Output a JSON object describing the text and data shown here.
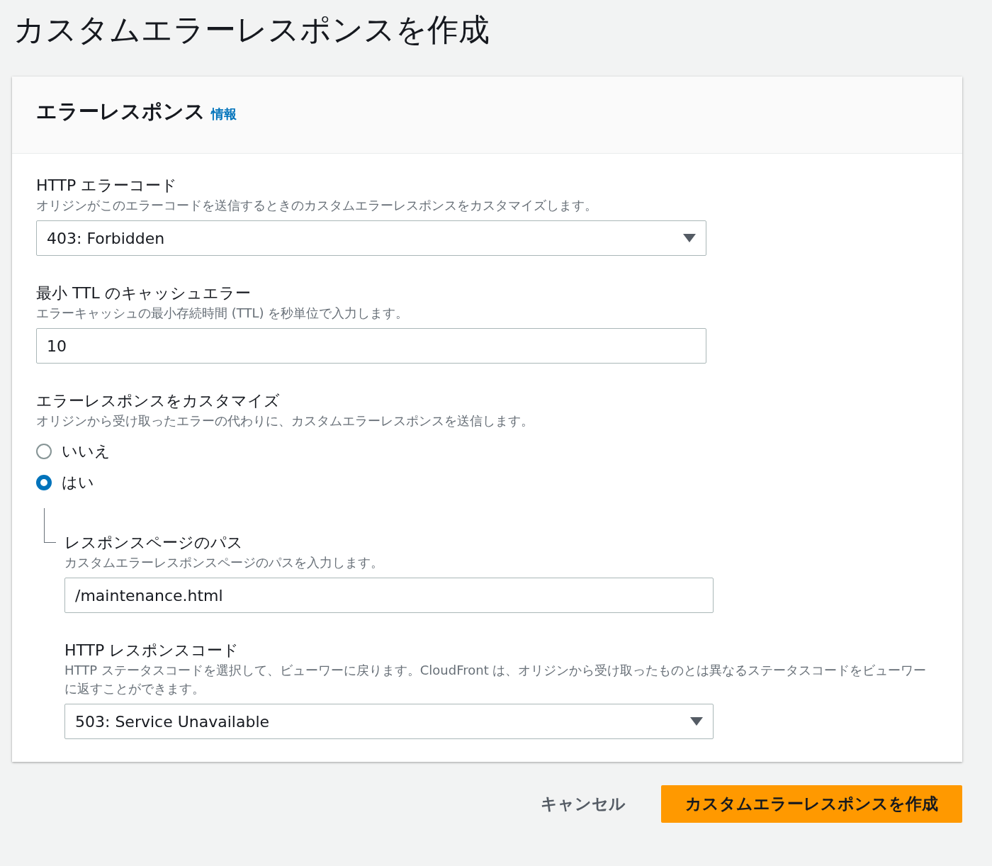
{
  "page_title": "カスタムエラーレスポンスを作成",
  "panel": {
    "title": "エラーレスポンス",
    "info_link": "情報"
  },
  "fields": [
    {
      "kind": "select",
      "label": "HTTP エラーコード",
      "description": "オリジンがこのエラーコードを送信するときのカスタムエラーレスポンスをカスタマイズします。",
      "value": "403: Forbidden"
    },
    {
      "kind": "input",
      "label": "最小 TTL のキャッシュエラー",
      "description": "エラーキャッシュの最小存続時間 (TTL) を秒単位で入力します。",
      "value": "10"
    },
    {
      "kind": "radio",
      "label": "エラーレスポンスをカスタマイズ",
      "description": "オリジンから受け取ったエラーの代わりに、カスタムエラーレスポンスを送信します。",
      "options": [
        {
          "label": "いいえ",
          "selected": false
        },
        {
          "label": "はい",
          "selected": true
        }
      ],
      "nested": [
        {
          "kind": "input",
          "label": "レスポンスページのパス",
          "description": "カスタムエラーレスポンスページのパスを入力します。",
          "value": "/maintenance.html"
        },
        {
          "kind": "select",
          "label": "HTTP レスポンスコード",
          "description": "HTTP ステータスコードを選択して、ビューワーに戻ります。CloudFront は、オリジンから受け取ったものとは異なるステータスコードをビューワーに返すことができます。",
          "value": "503: Service Unavailable"
        }
      ]
    }
  ],
  "buttons": [
    {
      "kind": "link",
      "label": "キャンセル"
    },
    {
      "kind": "primary",
      "label": "カスタムエラーレスポンスを作成"
    }
  ]
}
